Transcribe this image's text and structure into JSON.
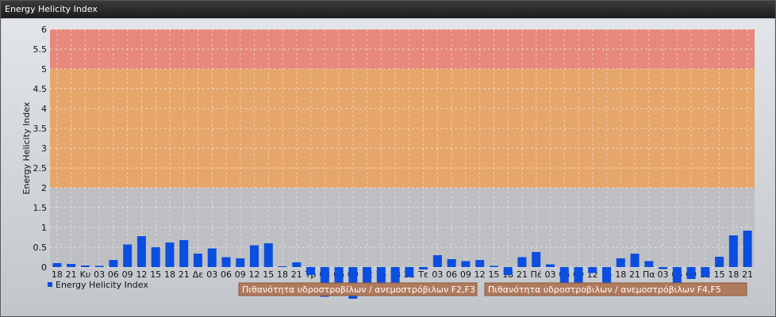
{
  "window": {
    "title": "Energy Helicity Index"
  },
  "colors": {
    "bar": "#0b4ee0",
    "band_low": "#bdbfc3",
    "band_mid": "#e6a56a",
    "band_high": "#e6897a",
    "badge": "#b07a5c"
  },
  "chart_data": {
    "type": "bar",
    "title": "",
    "ylabel": "Energy Helicity Index",
    "ylim": [
      0,
      6
    ],
    "yticks": [
      0,
      0.5,
      1,
      1.5,
      2,
      2.5,
      3,
      3.5,
      4,
      4.5,
      5,
      5.5,
      6
    ],
    "grid": true,
    "legend": {
      "label": "Energy Helicity Index",
      "placement": "bottom-left"
    },
    "categories": [
      "18",
      "21",
      "Κυ",
      "03",
      "06",
      "09",
      "12",
      "15",
      "18",
      "21",
      "Δε",
      "03",
      "06",
      "09",
      "12",
      "15",
      "18",
      "21",
      "Τρ",
      "03",
      "06",
      "09",
      "12",
      "15",
      "18",
      "21",
      "Τε",
      "03",
      "06",
      "09",
      "12",
      "15",
      "18",
      "21",
      "Πέ",
      "03",
      "06",
      "09",
      "12",
      "15",
      "18",
      "21",
      "Πα",
      "03",
      "06",
      "09",
      "12",
      "15",
      "18",
      "21"
    ],
    "series": [
      {
        "values": [
          0.1,
          0.08,
          0.04,
          0.03,
          0.18,
          0.57,
          0.78,
          0.5,
          0.62,
          0.68,
          0.34,
          0.47,
          0.25,
          0.22,
          0.55,
          0.6,
          0.02,
          0.12,
          -0.2,
          -0.75,
          -0.65,
          -0.8,
          -0.4,
          -0.45,
          -0.6,
          -0.25,
          -0.06,
          0.3,
          0.2,
          0.15,
          0.18,
          0.03,
          -0.2,
          0.25,
          0.38,
          0.07,
          -0.5,
          -0.6,
          -0.15,
          -0.65,
          0.22,
          0.34,
          0.15,
          -0.05,
          -0.5,
          -0.3,
          -0.25,
          0.26,
          0.8,
          0.92
        ]
      }
    ],
    "bands": [
      {
        "from": 0,
        "to": 2,
        "label": ""
      },
      {
        "from": 2,
        "to": 5,
        "label": "Πιθανότητα υδροστροβίλων / ανεμοστρόβιλων F2,F3"
      },
      {
        "from": 5,
        "to": 6,
        "label": "Πιθανότητα υδροστροβιλων / ανεμοστρόβιλων F4,F5"
      }
    ]
  }
}
